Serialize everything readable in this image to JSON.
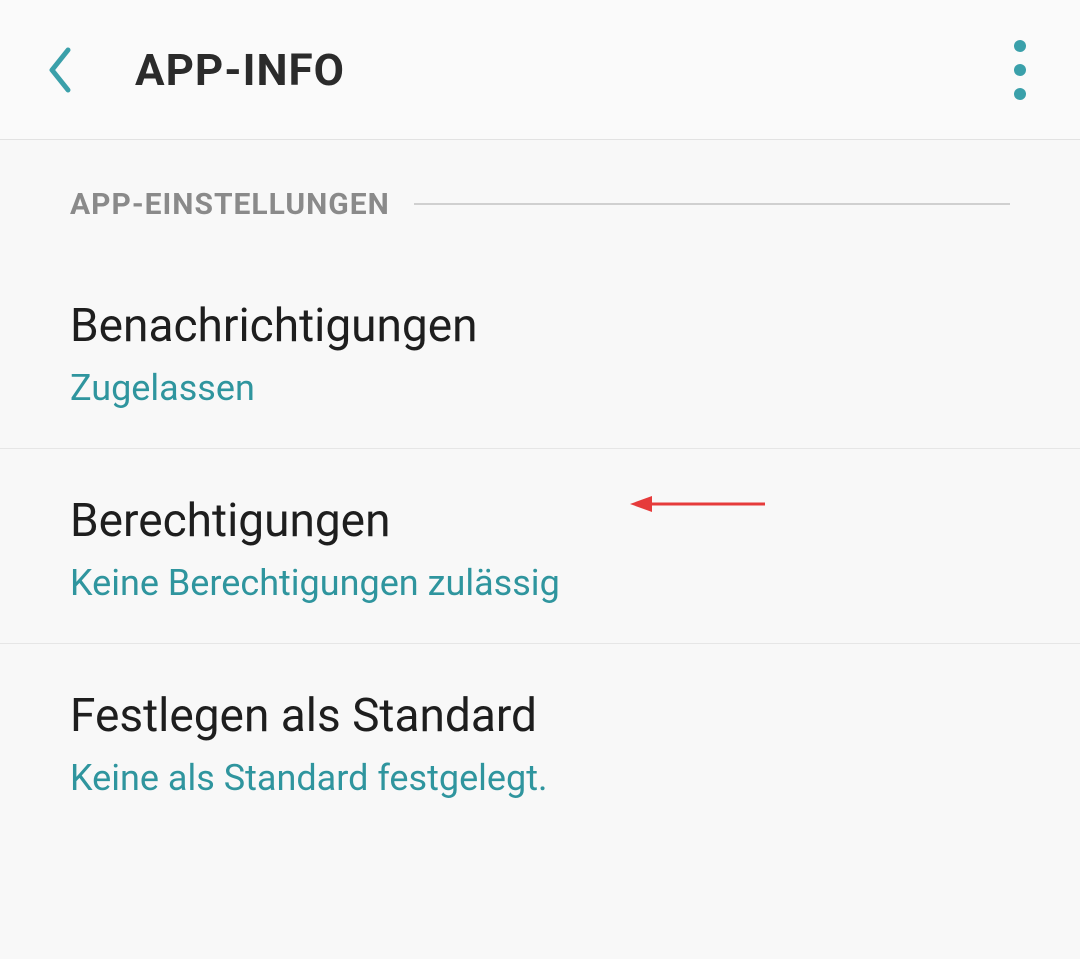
{
  "header": {
    "title": "APP-INFO"
  },
  "section_label": "APP-EINSTELLUNGEN",
  "items": [
    {
      "title": "Benachrichtigungen",
      "subtitle": "Zugelassen"
    },
    {
      "title": "Berechtigungen",
      "subtitle": "Keine Berechtigungen zulässig"
    },
    {
      "title": "Festlegen als Standard",
      "subtitle": "Keine als Standard festgelegt."
    }
  ],
  "colors": {
    "accent": "#3aa0aa",
    "subtitle": "#2f959e",
    "text": "#1e1e1e",
    "muted": "#8a8a8a",
    "annotation": "#e63b3b"
  }
}
